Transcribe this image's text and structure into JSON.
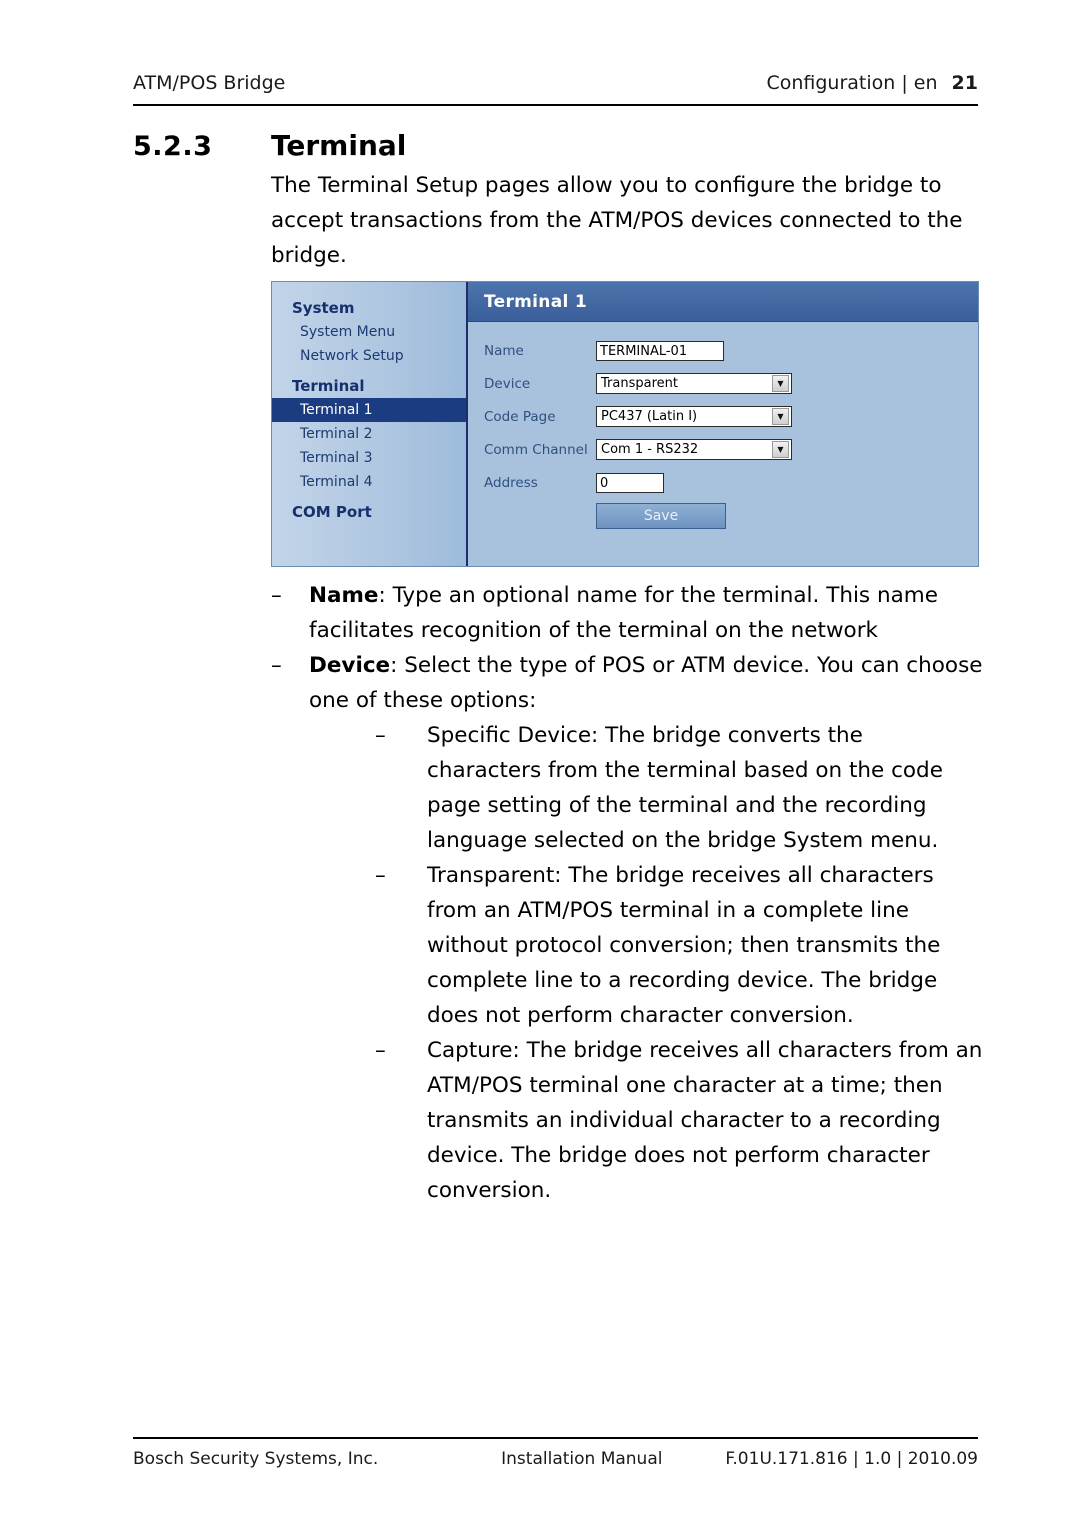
{
  "header": {
    "left": "ATM/POS Bridge",
    "right": "Configuration | en",
    "page_number": "21"
  },
  "section": {
    "number": "5.2.3",
    "title": "Terminal",
    "intro": "The Terminal Setup pages allow you to configure the bridge to accept transactions from the ATM/POS devices connected to the bridge."
  },
  "figure": {
    "sidebar": {
      "system_heading": "System",
      "system_items": [
        "System Menu",
        "Network Setup"
      ],
      "terminal_heading": "Terminal",
      "terminal_items": [
        "Terminal 1",
        "Terminal 2",
        "Terminal 3",
        "Terminal 4"
      ],
      "selected_item": "Terminal 1",
      "com_port_heading": "COM Port"
    },
    "panel": {
      "title": "Terminal 1",
      "fields": [
        {
          "label": "Name",
          "value": "TERMINAL-01",
          "type": "text"
        },
        {
          "label": "Device",
          "value": "Transparent",
          "type": "select"
        },
        {
          "label": "Code Page",
          "value": "PC437 (Latin I)",
          "type": "select"
        },
        {
          "label": "Comm Channel",
          "value": "Com 1 - RS232",
          "type": "select"
        },
        {
          "label": "Address",
          "value": "0",
          "type": "text-small"
        }
      ],
      "save_label": "Save"
    }
  },
  "bullets": {
    "dash": "–",
    "name_label": "Name",
    "name_text": ": Type an optional name for the terminal. This name facilitates recognition of the terminal on the network",
    "device_label": "Device",
    "device_text": ": Select the type of POS or ATM device. You can choose one of these options:",
    "sub1": "Specific Device: The bridge converts the characters from the terminal based on the code page setting of the terminal and the recording language selected on the bridge System menu.",
    "sub2": "Transparent: The bridge receives all characters from an ATM/POS terminal in a complete line without protocol conversion; then transmits the complete line to a recording device. The bridge does not perform character conversion.",
    "sub3": "Capture: The bridge receives all characters from an ATM/POS terminal one character at a time; then transmits an individual character to a recording device. The bridge does not perform character conversion."
  },
  "footer": {
    "left": "Bosch Security Systems, Inc.",
    "center": "Installation Manual",
    "right": "F.01U.171.816 | 1.0 | 2010.09"
  }
}
